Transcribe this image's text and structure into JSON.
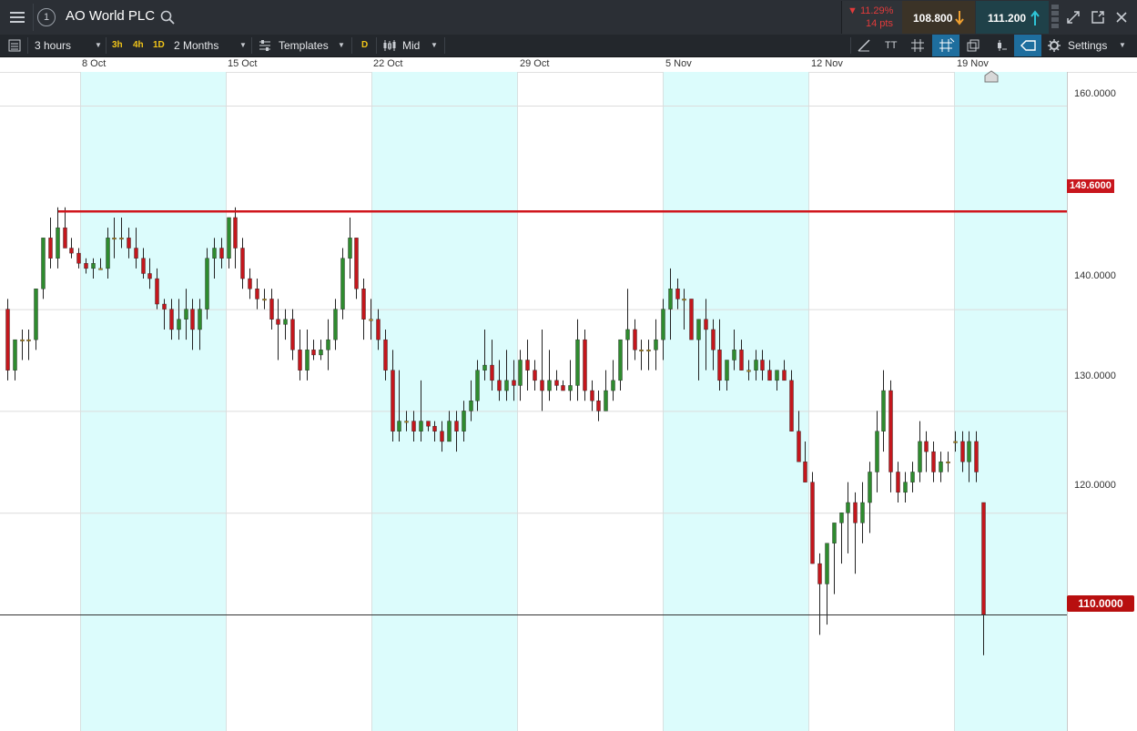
{
  "header": {
    "title": "AO World PLC",
    "change_pct": "▼ 11.29%",
    "change_pts": "14 pts",
    "sell_price": "108.800",
    "buy_price": "111.200",
    "info_badge": "1"
  },
  "toolbar": {
    "interval": "3 hours",
    "quick_3h": "3h",
    "quick_4h": "4h",
    "quick_1d": "1D",
    "range": "2 Months",
    "templates": "Templates",
    "d_button": "D",
    "price_type": "Mid",
    "settings": "Settings",
    "text_tool": "TT"
  },
  "chart_data": {
    "type": "candlestick",
    "instrument": "AO World PLC",
    "x_labels": [
      "8 Oct",
      "15 Oct",
      "22 Oct",
      "29 Oct",
      "5 Nov",
      "12 Nov",
      "19 Nov"
    ],
    "y_ticks": [
      "160.0000",
      "140.0000",
      "130.0000",
      "120.0000"
    ],
    "ylim": [
      106,
      162
    ],
    "horizontal_line_label": "149.6000",
    "horizontal_line_value": 149.6,
    "current_price_label": "110.0000",
    "current_price_value": 110.0,
    "colors": {
      "up": "#2e8b2e",
      "down": "#c4161c",
      "doji": "#d4a017",
      "weekend_band": "#dcfcfc",
      "line": "#d0161d"
    },
    "candles": [
      [
        140,
        141,
        133,
        134
      ],
      [
        134,
        137,
        133,
        137
      ],
      [
        137,
        138,
        135,
        137
      ],
      [
        137,
        138,
        135,
        137
      ],
      [
        137,
        142,
        136,
        142
      ],
      [
        142,
        147,
        141,
        147
      ],
      [
        147,
        149,
        144,
        145
      ],
      [
        145,
        150,
        144,
        148
      ],
      [
        148,
        150,
        146,
        146
      ],
      [
        146,
        147,
        145,
        145.5
      ],
      [
        145.5,
        146,
        144,
        144.5
      ],
      [
        144.5,
        145,
        143.5,
        144
      ],
      [
        144,
        145,
        143,
        144.5
      ],
      [
        144,
        145,
        144,
        144
      ],
      [
        144,
        148,
        143,
        147
      ],
      [
        147,
        149,
        145,
        147
      ],
      [
        147,
        149,
        146,
        147
      ],
      [
        147,
        148,
        145,
        146
      ],
      [
        146,
        148,
        144,
        145
      ],
      [
        145,
        146,
        143,
        143.5
      ],
      [
        143.5,
        145,
        142,
        143
      ],
      [
        143,
        144,
        140,
        140.5
      ],
      [
        140.5,
        141,
        138,
        140
      ],
      [
        140,
        141,
        137,
        138
      ],
      [
        138,
        141,
        137,
        139
      ],
      [
        139,
        142,
        137,
        140
      ],
      [
        140,
        141,
        136,
        138
      ],
      [
        138,
        141,
        136,
        140
      ],
      [
        140,
        146,
        139,
        145
      ],
      [
        145,
        147,
        143,
        146
      ],
      [
        146,
        147,
        144,
        145
      ],
      [
        145,
        149,
        144,
        149
      ],
      [
        149,
        150,
        144,
        146
      ],
      [
        146,
        147,
        142,
        143
      ],
      [
        143,
        144,
        141,
        142
      ],
      [
        142,
        143,
        140,
        141
      ],
      [
        141,
        142,
        140,
        141
      ],
      [
        141,
        142,
        138,
        139
      ],
      [
        139,
        141,
        135,
        138.5
      ],
      [
        138.5,
        140,
        137,
        139
      ],
      [
        139,
        140,
        135,
        136
      ],
      [
        136,
        138,
        133,
        134
      ],
      [
        134,
        138,
        133,
        136
      ],
      [
        136,
        137,
        135,
        135.5
      ],
      [
        135.5,
        137,
        135,
        136
      ],
      [
        136,
        139,
        134,
        137
      ],
      [
        137,
        141,
        136,
        140
      ],
      [
        140,
        146,
        139,
        145
      ],
      [
        145,
        149,
        143,
        147
      ],
      [
        147,
        147,
        141,
        142
      ],
      [
        142,
        143,
        137,
        139
      ],
      [
        139,
        141,
        137,
        139
      ],
      [
        139,
        140,
        136,
        137
      ],
      [
        137,
        138,
        133,
        134
      ],
      [
        134,
        136,
        127,
        128
      ],
      [
        128,
        134,
        127,
        129
      ],
      [
        129,
        130,
        128,
        129
      ],
      [
        129,
        130,
        127,
        128
      ],
      [
        128,
        133,
        127,
        129
      ],
      [
        129,
        129,
        128,
        128.5
      ],
      [
        128.5,
        129,
        127,
        128
      ],
      [
        128,
        129,
        126,
        127
      ],
      [
        127,
        130,
        127,
        129
      ],
      [
        129,
        130,
        126,
        128
      ],
      [
        128,
        131,
        127,
        130
      ],
      [
        130,
        133,
        129,
        131
      ],
      [
        131,
        135,
        130,
        134
      ],
      [
        134,
        138,
        133,
        134.5
      ],
      [
        134.5,
        137,
        132,
        133
      ],
      [
        133,
        135,
        131,
        132
      ],
      [
        132,
        136,
        131,
        133
      ],
      [
        133,
        135,
        131,
        132.5
      ],
      [
        132.5,
        136,
        131,
        135
      ],
      [
        135,
        137,
        132,
        134
      ],
      [
        134,
        135,
        132,
        133
      ],
      [
        133,
        138,
        130,
        132
      ],
      [
        132,
        136,
        131,
        133
      ],
      [
        133,
        134,
        132,
        132.5
      ],
      [
        132.5,
        133,
        132,
        132
      ],
      [
        132,
        135,
        131,
        132.5
      ],
      [
        132.5,
        139,
        131,
        137
      ],
      [
        137,
        138,
        131,
        132
      ],
      [
        132,
        133,
        130,
        131
      ],
      [
        131,
        132,
        129,
        130
      ],
      [
        130,
        134,
        130,
        132
      ],
      [
        132,
        135,
        131,
        133
      ],
      [
        133,
        136,
        132,
        137
      ],
      [
        137,
        142,
        134,
        138
      ],
      [
        138,
        139,
        135,
        136
      ],
      [
        136,
        137,
        134,
        136
      ],
      [
        136,
        137,
        134,
        136
      ],
      [
        136,
        139,
        134,
        137
      ],
      [
        137,
        141,
        135,
        140
      ],
      [
        140,
        144,
        137,
        142
      ],
      [
        142,
        143,
        140,
        141
      ],
      [
        141,
        142,
        138,
        141
      ],
      [
        141,
        140,
        138,
        137
      ],
      [
        137,
        139,
        133,
        139
      ],
      [
        139,
        141,
        134,
        138
      ],
      [
        138,
        139,
        134,
        136
      ],
      [
        136,
        139,
        132,
        133
      ],
      [
        133,
        135,
        132,
        135
      ],
      [
        135,
        138,
        134,
        136
      ],
      [
        136,
        137,
        134,
        134
      ],
      [
        134,
        135,
        133,
        134
      ],
      [
        134,
        136,
        133,
        135
      ],
      [
        135,
        136,
        133,
        134
      ],
      [
        134,
        135,
        133,
        133
      ],
      [
        133,
        134,
        132,
        134
      ],
      [
        134,
        135,
        133,
        133
      ],
      [
        133,
        134,
        128,
        128
      ],
      [
        128,
        130,
        125,
        125
      ],
      [
        125,
        127,
        123,
        123
      ],
      [
        123,
        124,
        115,
        115
      ],
      [
        115,
        116,
        108,
        113
      ],
      [
        113,
        115,
        109,
        117
      ],
      [
        117,
        118,
        112,
        119
      ],
      [
        119,
        120,
        115,
        120
      ],
      [
        120,
        123,
        116,
        121
      ],
      [
        121,
        122,
        114,
        119
      ],
      [
        119,
        123,
        117,
        121
      ],
      [
        121,
        125,
        118,
        124
      ],
      [
        124,
        130,
        122,
        128
      ],
      [
        128,
        134,
        126,
        132
      ],
      [
        132,
        133,
        122,
        124
      ],
      [
        124,
        125,
        121,
        122
      ],
      [
        122,
        124,
        121,
        123
      ],
      [
        123,
        125,
        122,
        124
      ],
      [
        124,
        129,
        123,
        127
      ],
      [
        127,
        128,
        124,
        126
      ],
      [
        126,
        127,
        123,
        124
      ],
      [
        124,
        126,
        123,
        125
      ],
      [
        125,
        126,
        124,
        125
      ],
      [
        127,
        128,
        126,
        127
      ],
      [
        127,
        128,
        124,
        125
      ],
      [
        125,
        128,
        123,
        127
      ],
      [
        127,
        128,
        123,
        124
      ],
      [
        121,
        121,
        106,
        110
      ]
    ]
  }
}
